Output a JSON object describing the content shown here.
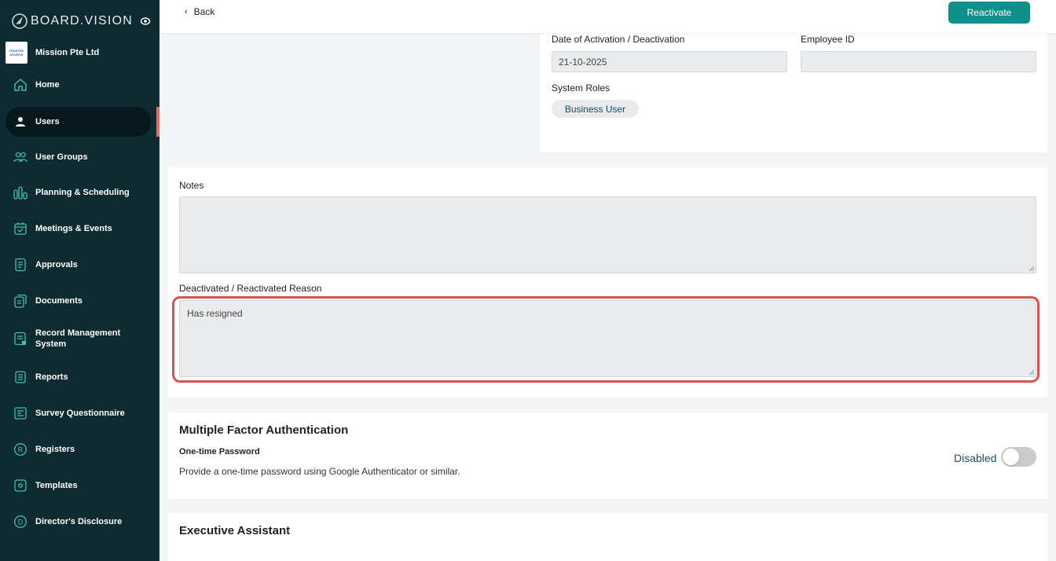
{
  "brand": {
    "name": "BOARD.VISION"
  },
  "organization": {
    "name": "Mission Pte Ltd",
    "logo_text": "TRUSTED SOURCE"
  },
  "sidebar": {
    "items": [
      {
        "label": "Home",
        "icon": "home-icon"
      },
      {
        "label": "Users",
        "icon": "user-icon",
        "active": true
      },
      {
        "label": "User Groups",
        "icon": "user-groups-icon"
      },
      {
        "label": "Planning & Scheduling",
        "icon": "bar-chart-icon"
      },
      {
        "label": "Meetings & Events",
        "icon": "calendar-check-icon"
      },
      {
        "label": "Approvals",
        "icon": "approvals-icon"
      },
      {
        "label": "Documents",
        "icon": "documents-icon"
      },
      {
        "label": "Record Management System",
        "icon": "record-icon"
      },
      {
        "label": "Reports",
        "icon": "reports-icon"
      },
      {
        "label": "Survey Questionnaire",
        "icon": "survey-icon"
      },
      {
        "label": "Registers",
        "icon": "registered-icon"
      },
      {
        "label": "Templates",
        "icon": "templates-icon"
      },
      {
        "label": "Director's Disclosure",
        "icon": "disclosure-icon"
      }
    ]
  },
  "topbar": {
    "back_label": "Back",
    "reactivate_label": "Reactivate"
  },
  "details": {
    "activation_label": "Date of Activation / Deactivation",
    "activation_value": "21-10-2025",
    "employee_id_label": "Employee ID",
    "employee_id_value": "",
    "system_roles_label": "System Roles",
    "system_roles": [
      "Business User"
    ]
  },
  "notes": {
    "label": "Notes",
    "value": "",
    "reason_label": "Deactivated / Reactivated Reason",
    "reason_value": "Has resigned"
  },
  "mfa": {
    "title": "Multiple Factor Authentication",
    "otp_title": "One-time Password",
    "otp_desc": "Provide a one-time password using Google Authenticator or similar.",
    "status_label": "Disabled",
    "enabled": false
  },
  "executive_assistant": {
    "title": "Executive Assistant"
  },
  "colors": {
    "sidebar": "#0d2b30",
    "accent": "#0f8f8a",
    "highlight": "#d9534a",
    "active_marker": "#e56a6a"
  }
}
